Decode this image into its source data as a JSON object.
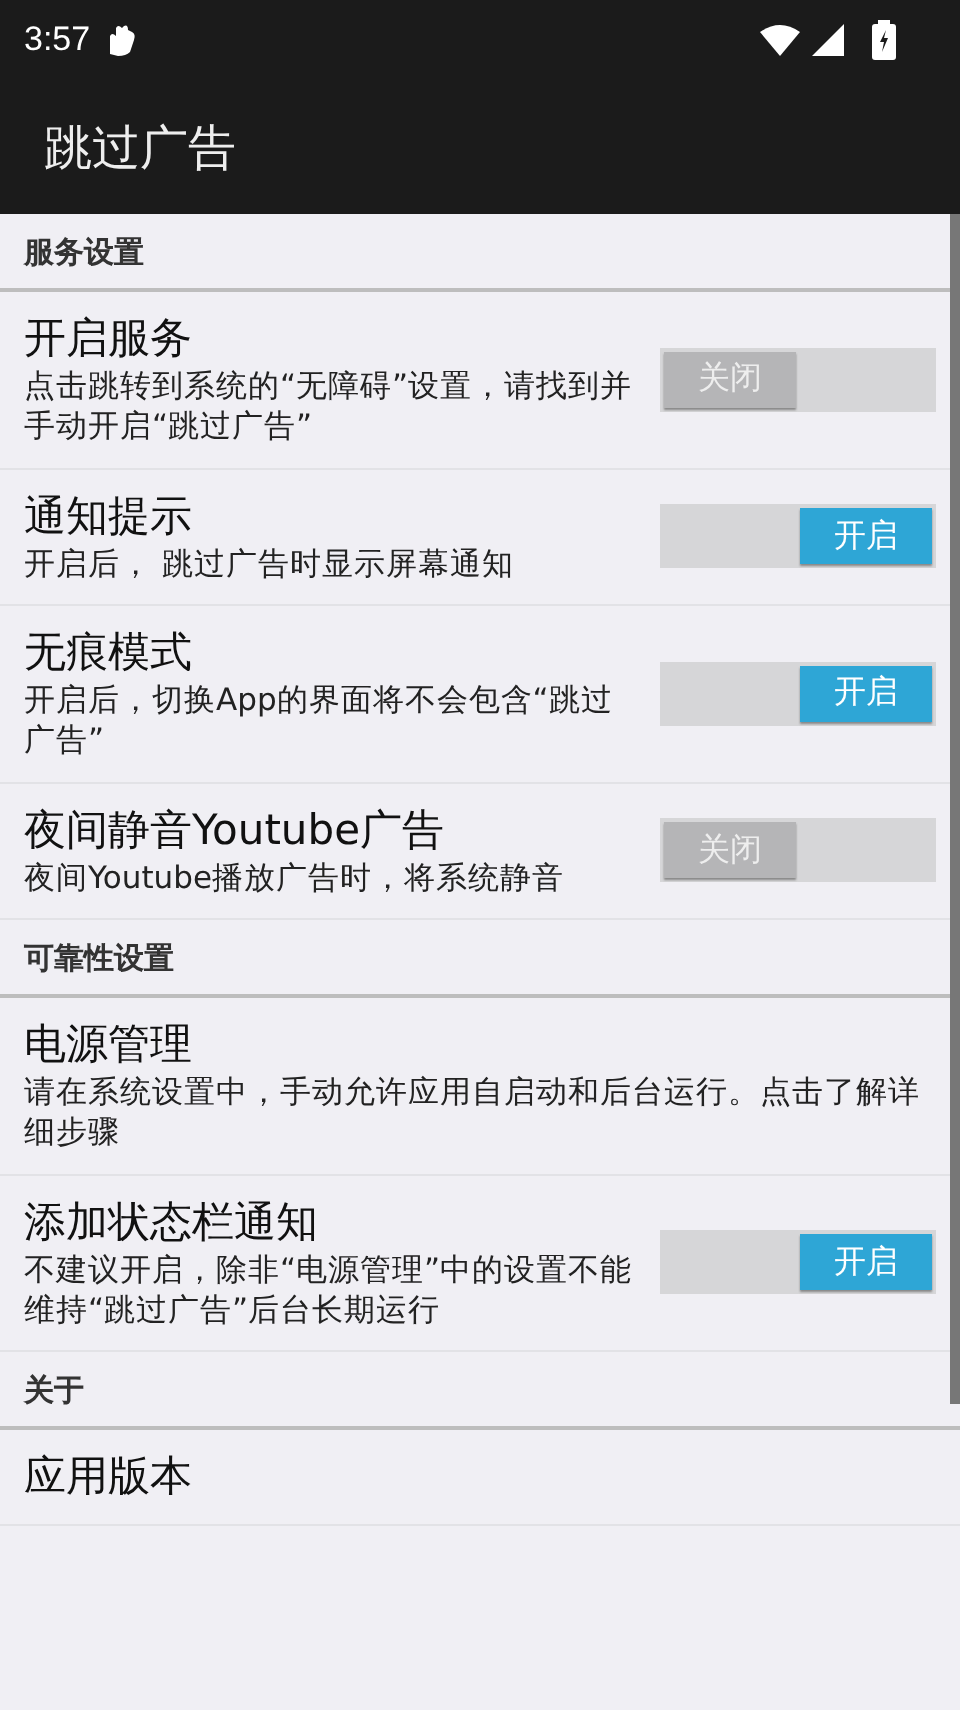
{
  "status_bar": {
    "time": "3:57"
  },
  "app_bar": {
    "title": "跳过广告"
  },
  "sections": [
    {
      "title": "服务设置",
      "items": [
        {
          "kind": "toggle",
          "title": "开启服务",
          "subtitle": "点击跳转到系统的“无障碍”设置，请找到并手动开启“跳过广告”",
          "on": false,
          "switch_label": "关闭"
        },
        {
          "kind": "toggle",
          "title": "通知提示",
          "subtitle": "开启后， 跳过广告时显示屏幕通知",
          "on": true,
          "switch_label": "开启"
        },
        {
          "kind": "toggle",
          "title": "无痕模式",
          "subtitle": "开启后，切换App的界面将不会包含“跳过广告”",
          "on": true,
          "switch_label": "开启"
        },
        {
          "kind": "toggle",
          "title": "夜间静音Youtube广告",
          "subtitle": "夜间Youtube播放广告时，将系统静音",
          "on": false,
          "switch_label": "关闭"
        }
      ]
    },
    {
      "title": "可靠性设置",
      "items": [
        {
          "kind": "link",
          "title": "电源管理",
          "subtitle": "请在系统设置中，手动允许应用自启动和后台运行。点击了解详细步骤"
        },
        {
          "kind": "toggle",
          "title": "添加状态栏通知",
          "subtitle": "不建议开启，除非“电源管理”中的设置不能维持“跳过广告”后台长期运行",
          "on": true,
          "switch_label": "开启"
        }
      ]
    },
    {
      "title": "关于",
      "items": [
        {
          "kind": "link",
          "title": "应用版本"
        }
      ]
    }
  ]
}
